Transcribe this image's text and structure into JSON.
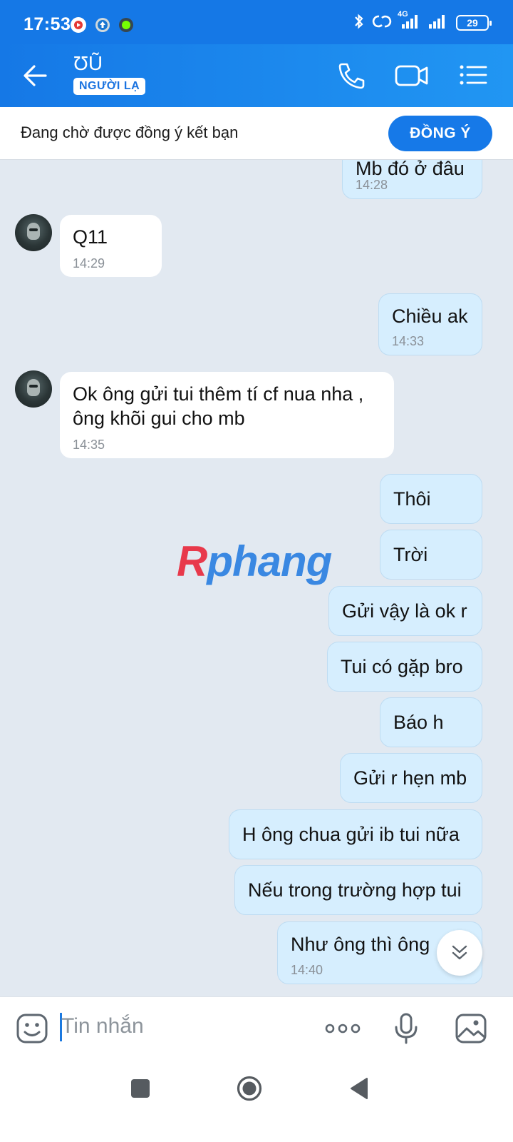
{
  "status_bar": {
    "time": "17:53",
    "network": "4G",
    "battery": "29",
    "icons": [
      "youtube-app-icon",
      "upload-app-icon",
      "green-app-icon",
      "bluetooth-icon",
      "link-icon",
      "signal-icon",
      "signal-icon-2",
      "battery-icon"
    ]
  },
  "header": {
    "contact_name": "ƱŨ",
    "badge": "NGƯỜI LẠ",
    "icons": [
      "back-arrow-icon",
      "phone-icon",
      "video-call-icon",
      "menu-list-icon"
    ]
  },
  "friend_request": {
    "text": "Đang chờ được đồng ý kết bạn",
    "button": "ĐỒNG Ý"
  },
  "messages": [
    {
      "from": "me",
      "text": "Mb đó ở đâu",
      "time": "14:28"
    },
    {
      "from": "them",
      "text": "Q11",
      "time": "14:29"
    },
    {
      "from": "me",
      "text": "Chiều ak",
      "time": "14:33"
    },
    {
      "from": "them",
      "line1": "Ok ông gửi tui thêm tí cf nua nha ,",
      "line2": "ông khõi gui cho mb",
      "time": "14:35"
    },
    {
      "from": "me",
      "text": "Thôi"
    },
    {
      "from": "me",
      "text": "Trời"
    },
    {
      "from": "me",
      "text": "Gửi vậy là ok r"
    },
    {
      "from": "me",
      "text": "Tui có gặp bro"
    },
    {
      "from": "me",
      "text": "Báo h"
    },
    {
      "from": "me",
      "text": "Gửi r hẹn mb"
    },
    {
      "from": "me",
      "text": "H ông chua gửi ib tui nữa"
    },
    {
      "from": "me",
      "text": "Nếu trong trường hợp tui"
    },
    {
      "from": "me",
      "text": "Như ông thì ông",
      "time": "14:40"
    }
  ],
  "watermark": {
    "part1": "R",
    "part2": "phang"
  },
  "input": {
    "placeholder": "Tin nhắn",
    "icons": [
      "emoji-icon",
      "more-options-icon",
      "microphone-icon",
      "image-icon"
    ]
  },
  "navigation": {
    "icons": [
      "recent-apps-icon",
      "home-icon",
      "back-icon"
    ]
  },
  "colors": {
    "header_blue": "#1578e6",
    "my_bubble": "#d6eefe",
    "chat_background": "#e2e9f1",
    "accent": "#1679e8"
  }
}
